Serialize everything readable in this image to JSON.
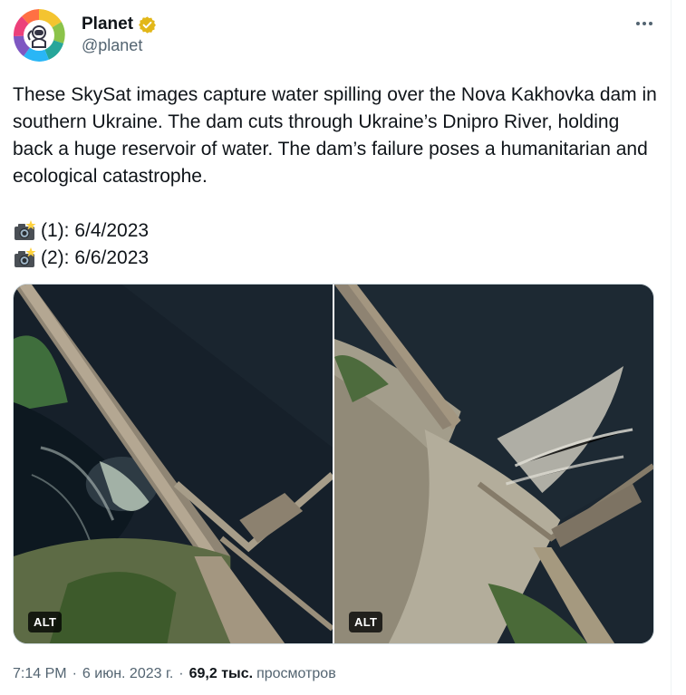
{
  "author": {
    "name": "Planet",
    "handle": "@planet",
    "verified_badge_color": "#e2b719"
  },
  "tweet": {
    "text": "These SkySat images capture water spilling over the Nova Kakhovka dam in southern Ukraine. The dam cuts through Ukraine’s Dnipro River, holding back a huge reservoir of water. The dam’s failure poses a humanitarian and ecological catastrophe.",
    "dates": [
      {
        "icon": "camera-flash-icon",
        "text": "(1): 6/4/2023"
      },
      {
        "icon": "camera-flash-icon",
        "text": "(2): 6/6/2023"
      }
    ]
  },
  "media": [
    {
      "description_icon": "satellite-image-before",
      "alt_label": "ALT"
    },
    {
      "description_icon": "satellite-image-after",
      "alt_label": "ALT"
    }
  ],
  "meta": {
    "time": "7:14 PM",
    "date": "6 июн. 2023 г.",
    "separator": "·",
    "views_count": "69,2 тыс.",
    "views_label": "просмотров"
  },
  "colors": {
    "text_primary": "#0f1419",
    "text_secondary": "#536471",
    "border": "#cfd9de"
  }
}
